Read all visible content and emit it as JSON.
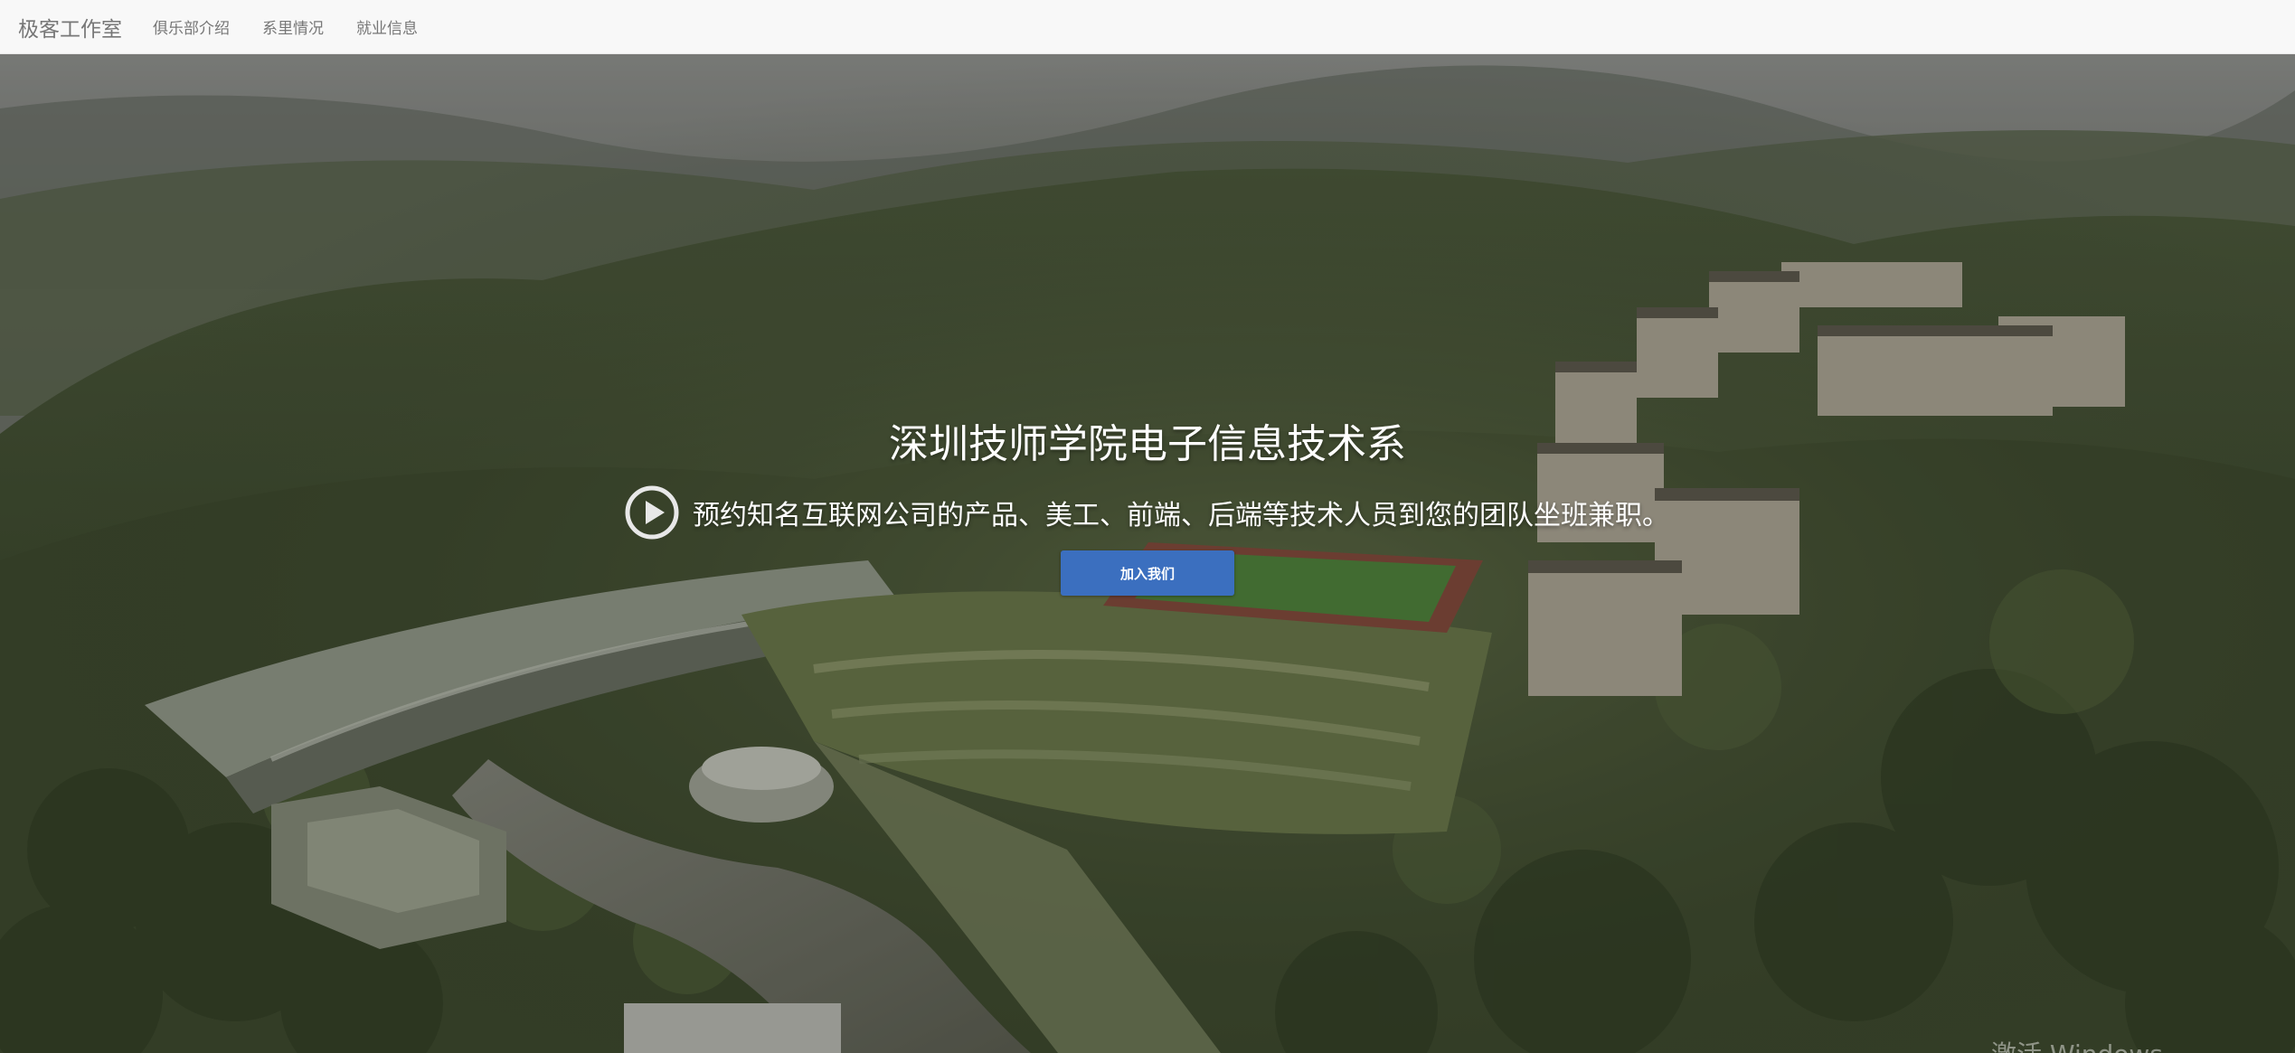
{
  "navbar": {
    "brand": "极客工作室",
    "links": [
      "俱乐部介绍",
      "系里情况",
      "就业信息"
    ]
  },
  "hero": {
    "title": "深圳技师学院电子信息技术系",
    "subtitle": "预约知名互联网公司的产品、美工、前端、后端等技术人员到您的团队坐班兼职。",
    "button_label": "加入我们",
    "background_image": "aerial-campus-photo",
    "play_icon": "play-circle-icon"
  },
  "watermark": "激活 Windows",
  "colors": {
    "navbar_bg": "#f8f8f8",
    "nav_text": "#777777",
    "button": "#3b6fbf",
    "hero_text": "#ffffff"
  }
}
